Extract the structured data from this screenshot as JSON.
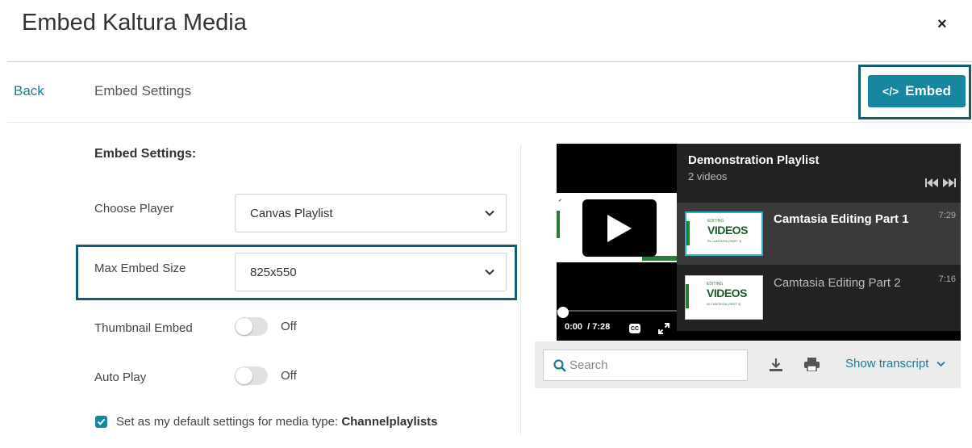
{
  "dialog": {
    "title": "Embed Kaltura Media",
    "close_icon": "×"
  },
  "nav": {
    "back_label": "Back",
    "breadcrumb": "Embed Settings",
    "embed_button": {
      "icon": "</>",
      "label": "Embed"
    }
  },
  "settings": {
    "heading": "Embed Settings:",
    "choose_player": {
      "label": "Choose Player",
      "value": "Canvas Playlist"
    },
    "max_embed_size": {
      "label": "Max Embed Size",
      "value": "825x550"
    },
    "thumbnail_embed": {
      "label": "Thumbnail Embed",
      "state": "Off"
    },
    "auto_play": {
      "label": "Auto Play",
      "state": "Off"
    },
    "default_settings": {
      "prefix": "Set as my default settings for media type:",
      "media_type": "Channelplaylists",
      "checked": true
    }
  },
  "player": {
    "playlist_title": "Demonstration Playlist",
    "playlist_count": "2 videos",
    "time_current": "0:00",
    "time_total": "/ 7:28",
    "cc_label": "CC",
    "items": [
      {
        "name": "Camtasia Editing Part 1",
        "duration": "7:29",
        "thumb_small": "EDITING",
        "thumb_big": "VIDEOS",
        "thumb_sub": "IN CAMTASIA (PART 1)"
      },
      {
        "name": "Camtasia Editing Part 2",
        "duration": "7:16",
        "thumb_small": "EDITING",
        "thumb_big": "VIDEOS",
        "thumb_sub": "IN CAMTASIA (PART 2)"
      }
    ]
  },
  "transcript": {
    "search_placeholder": "Search",
    "show_label": "Show transcript"
  },
  "colors": {
    "accent": "#1787a0",
    "highlight_outline": "#0f5e73",
    "link": "#1a7a94"
  }
}
